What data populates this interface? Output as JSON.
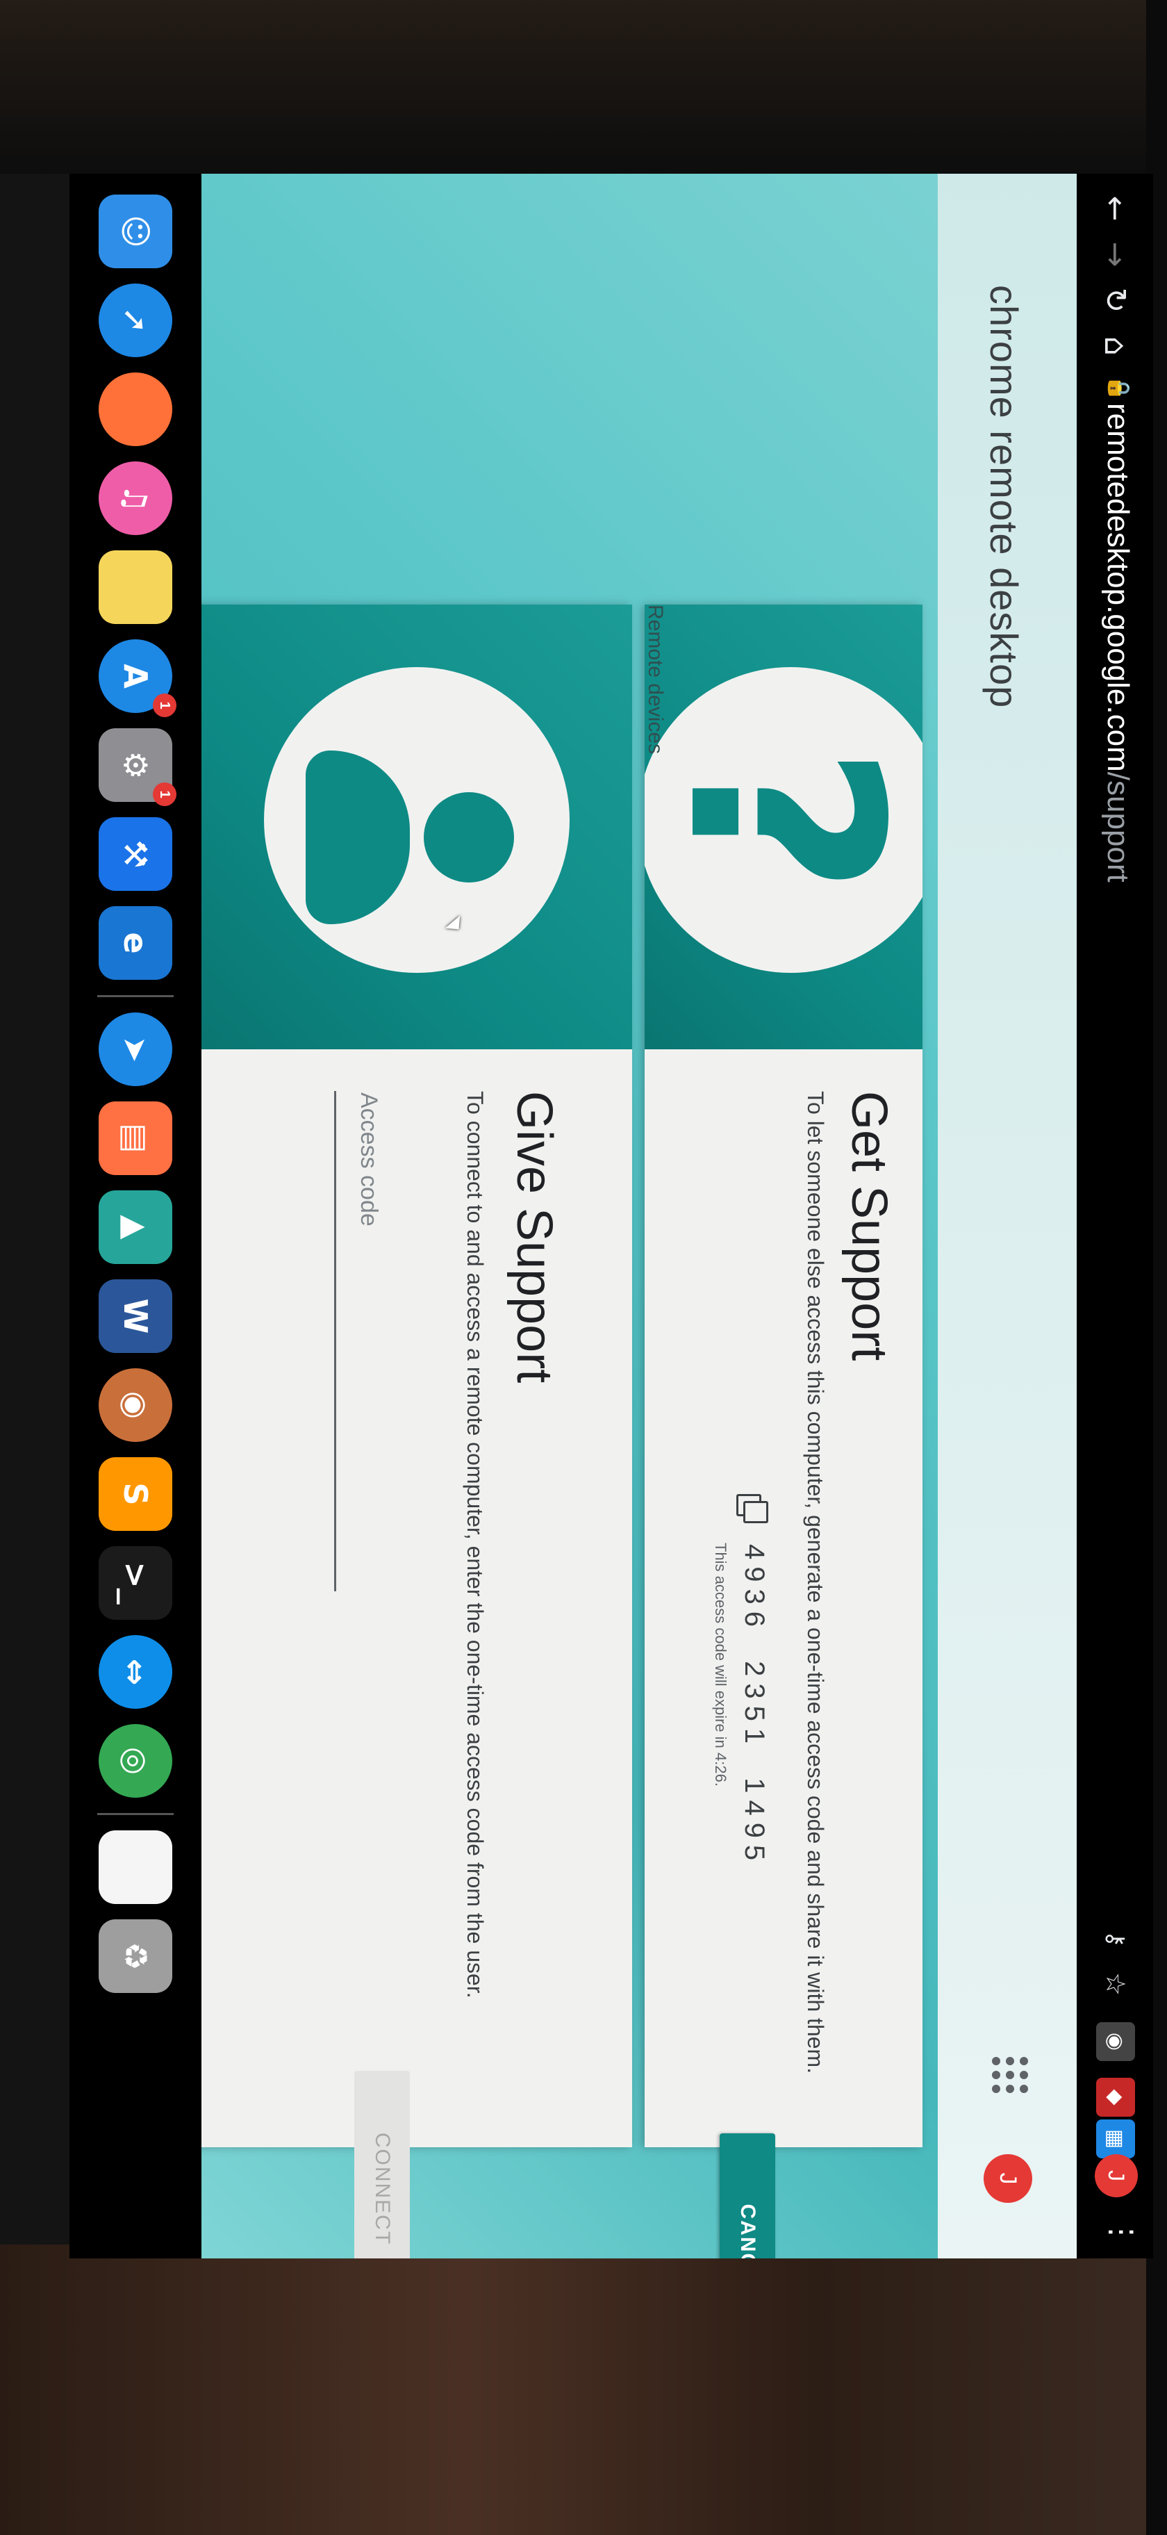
{
  "browser": {
    "url_host": "remotedesktop.google.com",
    "url_path": "/support",
    "avatar_letter": "J"
  },
  "page": {
    "app_title": "chrome remote desktop",
    "avatar_letter": "J",
    "remote_devices_label": "Remote devices"
  },
  "get_support": {
    "title": "Get Support",
    "description": "To let someone else access this computer, generate a one-time access code and share it with them.",
    "access_code": "4936 2351 1495",
    "expire_text": "This access code will expire in 4:26.",
    "cancel_label": "CANCEL"
  },
  "give_support": {
    "title": "Give Support",
    "description": "To connect to and access a remote computer, enter the one-time access code from the user.",
    "input_placeholder": "Access code",
    "connect_label": "CONNECT"
  },
  "dock": {
    "apps": [
      {
        "name": "finder-icon",
        "glyph": "☺",
        "color": "#2f8fe8"
      },
      {
        "name": "safari-icon",
        "glyph": "➚",
        "color": "#1e88e5"
      },
      {
        "name": "firefox-icon",
        "glyph": "",
        "color": "#ff7139"
      },
      {
        "name": "itunes-icon",
        "glyph": "♫",
        "color": "#ef5da8"
      },
      {
        "name": "notes-icon",
        "glyph": "",
        "color": "#f5d65b"
      },
      {
        "name": "app-store-icon",
        "glyph": "A",
        "color": "#1e88e5",
        "badge": "1"
      },
      {
        "name": "system-preferences-icon",
        "glyph": "⚙",
        "color": "#8e8e93",
        "badge": "1"
      },
      {
        "name": "xcode-icon",
        "glyph": "⚒",
        "color": "#1a73e8"
      },
      {
        "name": "edge-icon",
        "glyph": "e",
        "color": "#1976d2"
      },
      {
        "name": "paper-plane-icon",
        "glyph": "➤",
        "color": "#1e88e5"
      },
      {
        "name": "keynote-icon",
        "glyph": "▤",
        "color": "#ff7043"
      },
      {
        "name": "vpn-icon",
        "glyph": "▲",
        "color": "#26a69a"
      },
      {
        "name": "word-icon",
        "glyph": "W",
        "color": "#2b579a"
      },
      {
        "name": "shell-icon",
        "glyph": "◉",
        "color": "#c96f3a"
      },
      {
        "name": "sublime-text-icon",
        "glyph": "S",
        "color": "#ff9800"
      },
      {
        "name": "terminal-icon",
        "glyph": ">_",
        "color": "#1b1b1b"
      },
      {
        "name": "teamviewer-icon",
        "glyph": "⇔",
        "color": "#0e8ee9"
      },
      {
        "name": "chrome-icon",
        "glyph": "◎",
        "color": "#34a853"
      },
      {
        "name": "document-icon",
        "glyph": "",
        "color": "#f5f5f5"
      },
      {
        "name": "trash-icon",
        "glyph": "♻",
        "color": "#9e9e9e"
      }
    ]
  }
}
